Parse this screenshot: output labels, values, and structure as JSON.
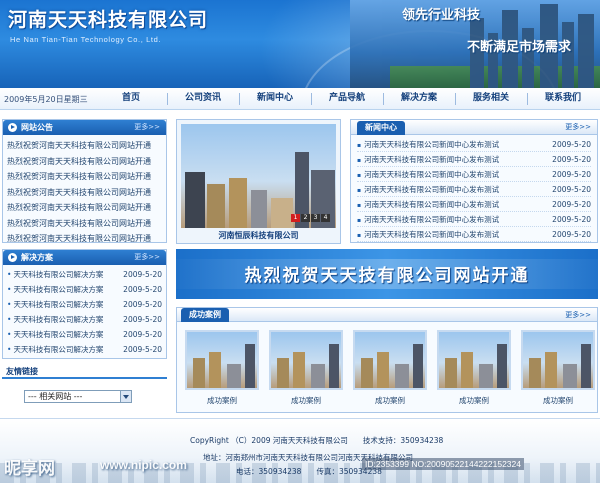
{
  "header": {
    "logo_cn": "河南天天科技有限公司",
    "logo_en": "He Nan Tian-Tian Technology Co., Ltd.",
    "slogan1": "领先行业科技",
    "slogan2": "不断满足市场需求"
  },
  "nav": {
    "date": "2009年5月20日星期三",
    "items": [
      "首页",
      "公司资讯",
      "新闻中心",
      "产品导航",
      "解决方案",
      "服务相关",
      "联系我们"
    ]
  },
  "notice": {
    "title": "网站公告",
    "more": "更多>>",
    "items": [
      "热烈祝贺河南天天科技有限公司网站开通",
      "热烈祝贺河南天天科技有限公司网站开通",
      "热烈祝贺河南天天科技有限公司网站开通",
      "热烈祝贺河南天天科技有限公司网站开通",
      "热烈祝贺河南天天科技有限公司网站开通",
      "热烈祝贺河南天天科技有限公司网站开通",
      "热烈祝贺河南天天科技有限公司网站开通"
    ]
  },
  "solution": {
    "title": "解决方案",
    "more": "更多>>",
    "items": [
      {
        "title": "天天科技有限公司解决方案",
        "date": "2009-5-20"
      },
      {
        "title": "天天科技有限公司解决方案",
        "date": "2009-5-20"
      },
      {
        "title": "天天科技有限公司解决方案",
        "date": "2009-5-20"
      },
      {
        "title": "天天科技有限公司解决方案",
        "date": "2009-5-20"
      },
      {
        "title": "天天科技有限公司解决方案",
        "date": "2009-5-20"
      },
      {
        "title": "天天科技有限公司解决方案",
        "date": "2009-5-20"
      }
    ]
  },
  "links": {
    "title": "友情链接",
    "select_value": "--- 相关网站 ---"
  },
  "photo": {
    "caption": "河南恒辰科技有限公司",
    "slides": [
      "1",
      "2",
      "3",
      "4"
    ],
    "active_slide": "1"
  },
  "news": {
    "title": "新闻中心",
    "more": "更多>>",
    "items": [
      {
        "title": "河南天天科技有限公司新闻中心发布测试",
        "date": "2009-5-20"
      },
      {
        "title": "河南天天科技有限公司新闻中心发布测试",
        "date": "2009-5-20"
      },
      {
        "title": "河南天天科技有限公司新闻中心发布测试",
        "date": "2009-5-20"
      },
      {
        "title": "河南天天科技有限公司新闻中心发布测试",
        "date": "2009-5-20"
      },
      {
        "title": "河南天天科技有限公司新闻中心发布测试",
        "date": "2009-5-20"
      },
      {
        "title": "河南天天科技有限公司新闻中心发布测试",
        "date": "2009-5-20"
      },
      {
        "title": "河南天天科技有限公司新闻中心发布测试",
        "date": "2009-5-20"
      }
    ]
  },
  "banner": {
    "text": "热烈祝贺天天技有限公司网站开通"
  },
  "cases": {
    "title": "成功案例",
    "more": "更多>>",
    "items": [
      "成功案例",
      "成功案例",
      "成功案例",
      "成功案例",
      "成功案例"
    ]
  },
  "footer": {
    "copyright": "CopyRight （C）2009 河南天天科技有限公司　　技术支持：350934238",
    "address": "地址：河南郑州市河南天天科技有限公司河南天天科技有限公司",
    "phone": "电话：350934238　　传真：350934238"
  },
  "watermark": {
    "logo": "昵享网",
    "url": "www.nipic.com",
    "id": "ID:2353399 NO:20090522144222152324"
  },
  "colors": {
    "primary": "#1a5fb0",
    "header_blue": "#2e8be0",
    "text": "#23466f"
  }
}
